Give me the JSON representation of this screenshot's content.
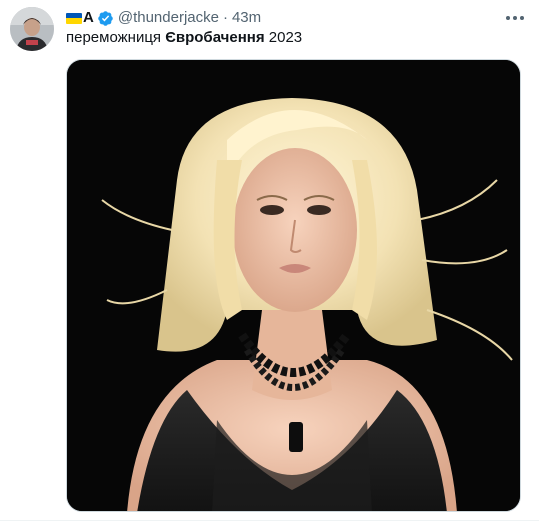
{
  "tweet": {
    "author": {
      "flag_icon": "ukraine-flag-icon",
      "display_name": "A",
      "verified_icon": "verified-badge-icon",
      "verified_color": "#1d9bf0",
      "handle": "@thunderjacke",
      "separator": "·",
      "timestamp": "43m"
    },
    "text_plain": "переможниця ",
    "text_bold": "Євробачення",
    "text_tail": " 2023",
    "more_icon": "more-options-icon"
  }
}
